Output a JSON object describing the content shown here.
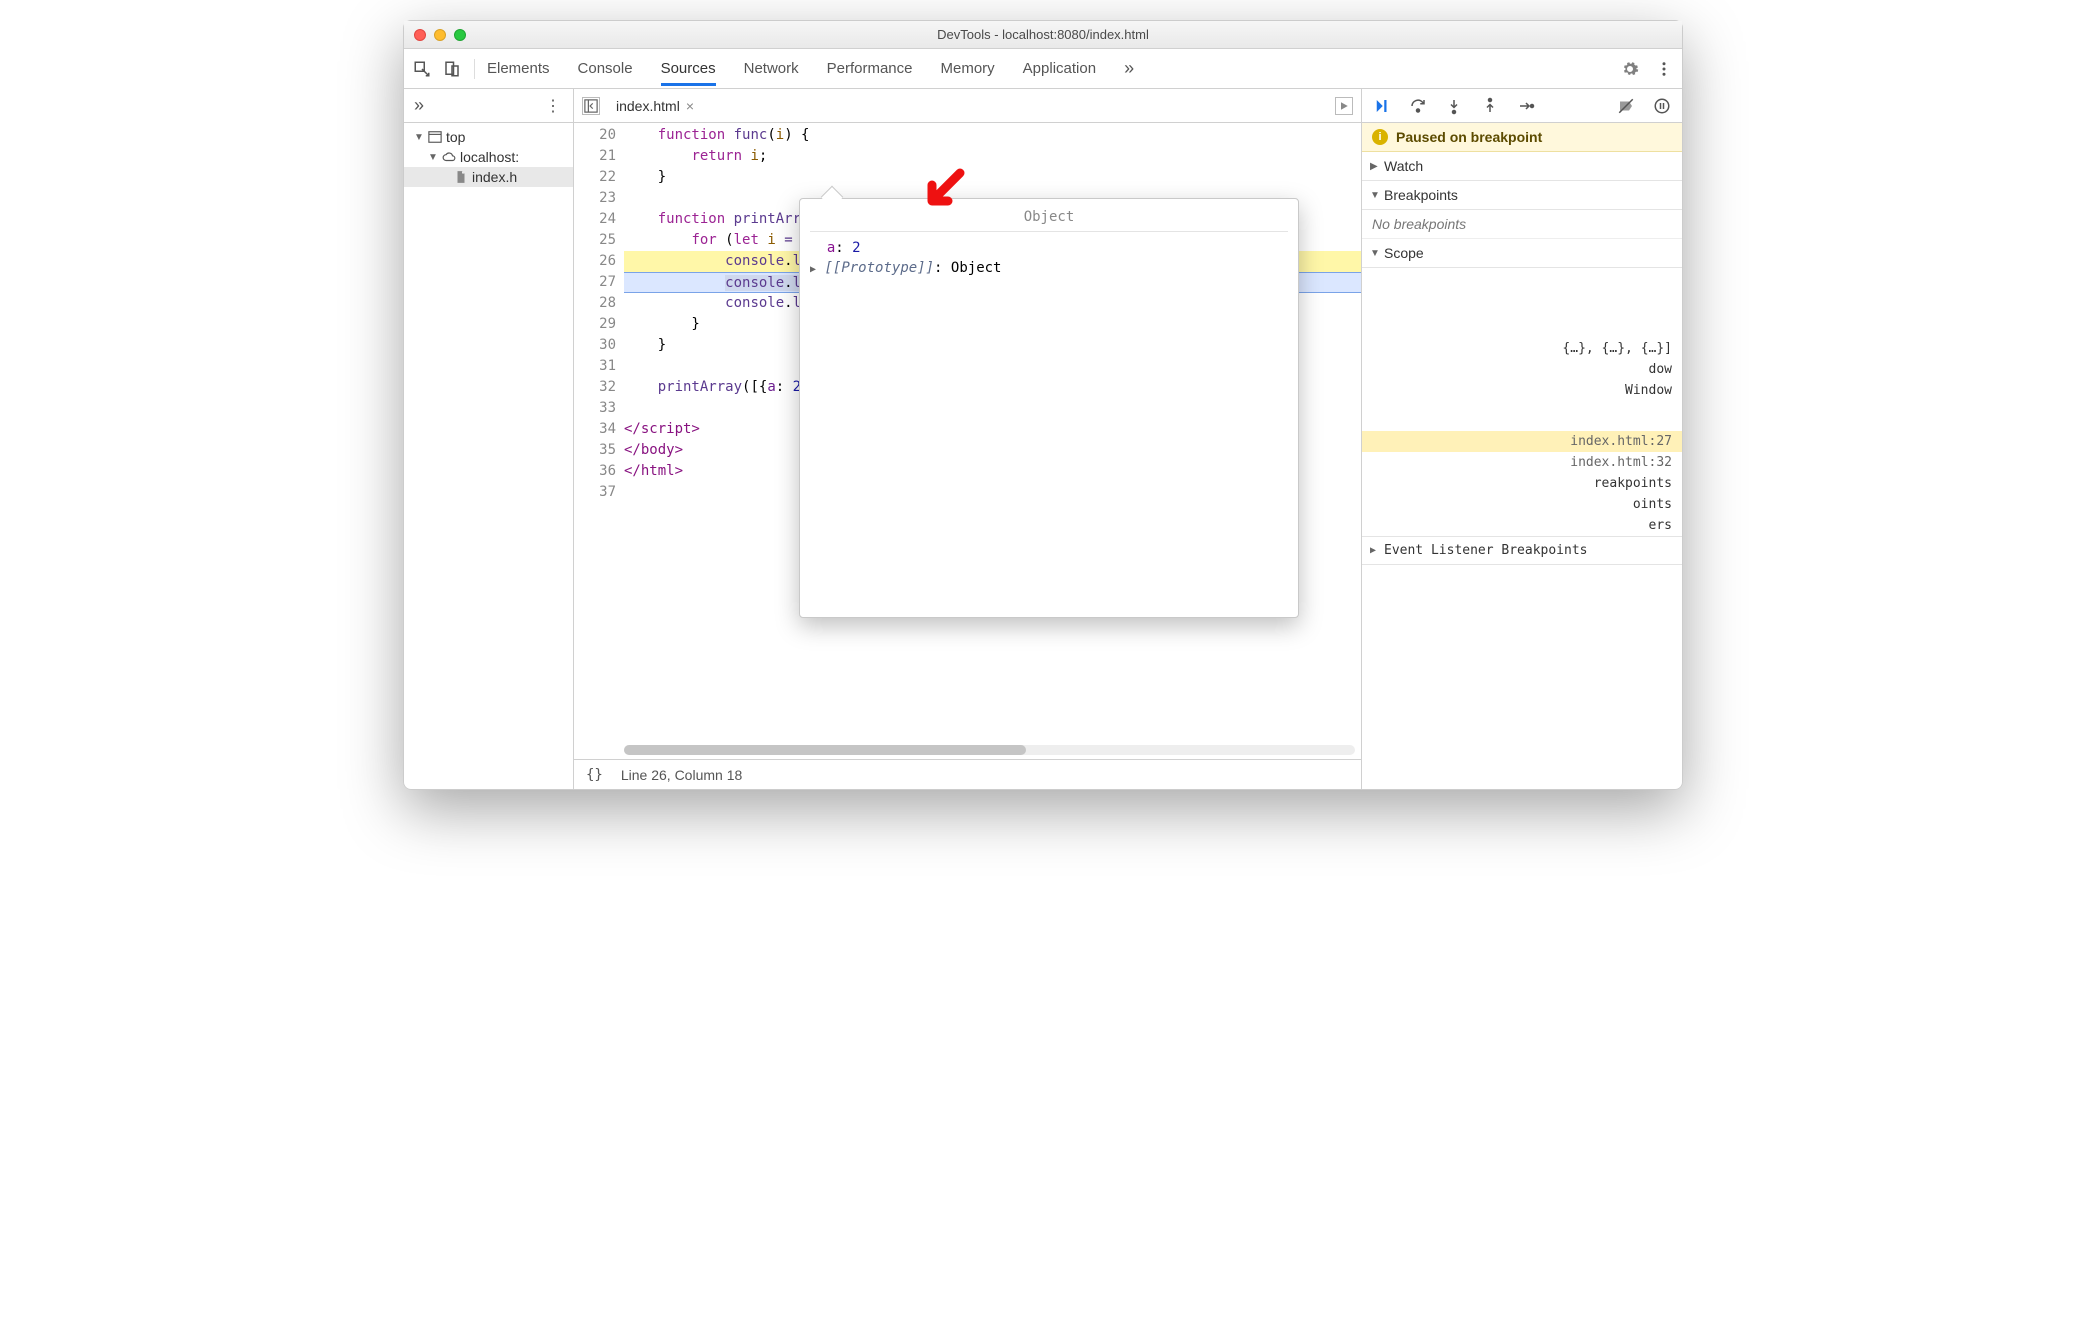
{
  "window": {
    "title": "DevTools - localhost:8080/index.html"
  },
  "mainTabs": {
    "items": [
      "Elements",
      "Console",
      "Sources",
      "Network",
      "Performance",
      "Memory",
      "Application"
    ],
    "overflow": "»",
    "active": "Sources"
  },
  "leftNav": {
    "overflow": "»",
    "more": "⋮",
    "tree": {
      "top": "top",
      "host": "localhost:",
      "file": "index.h"
    }
  },
  "fileTabs": {
    "toggleTip": "Toggle navigator",
    "active": {
      "name": "index.html",
      "close": "×"
    },
    "runTip": "Run snippet"
  },
  "editor": {
    "startLine": 20,
    "lines": [
      {
        "n": 20,
        "html": "    <span class='kw'>function</span> <span class='fn'>func</span>(<span class='param'>i</span>) {"
      },
      {
        "n": 21,
        "html": "        <span class='kw'>return</span> <span class='param'>i</span>;"
      },
      {
        "n": 22,
        "html": "    }"
      },
      {
        "n": 23,
        "html": ""
      },
      {
        "n": 24,
        "html": "    <span class='kw'>function</span> <span class='fn'>printArray</span>(<span class='param'>arr</span>) {  <span class='inline-hint'>arr = (3) [{…}, {…}, {…}</span>"
      },
      {
        "n": 25,
        "html": "        <span class='kw'>for</span> (<span class='kw'>let</span> <span class='param'>i</span> <span class='op'>=</span> <span class='num'>0</span>; <span class='param'>i</span> <span class='op'>&lt;</span> <span class='param'>arr</span>.<span class='prop'>length</span>; <span class='op'>++</span><span class='param'>i</span>) {"
      },
      {
        "n": 26,
        "cls": "hl-yellow",
        "html": "            <span class='fn'>console</span>.<span class='fn'>log</span>(<span class='param'>arr</span>[<span class='num'>0</span>].<span class='prop'>a</span>);"
      },
      {
        "n": 27,
        "cls": "hl-blue",
        "html": "            <span class='sel-token'><span class='fn'>console</span>.<span class='fn'>log</span>(<span class='param'>arr</span>[<span class='param'>i</span>]</span>.<span class='prop'>a</span>);"
      },
      {
        "n": 28,
        "html": "            <span class='fn'>console</span>.<span class='fn'>log</span>(<span class='param'>ar</span>"
      },
      {
        "n": 29,
        "html": "        }"
      },
      {
        "n": 30,
        "html": "    }"
      },
      {
        "n": 31,
        "html": ""
      },
      {
        "n": 32,
        "html": "    <span class='fn'>printArray</span>([{<span class='prop'>a</span>: <span class='num'>2</span>}, {"
      },
      {
        "n": 33,
        "html": ""
      },
      {
        "n": 34,
        "html": "<span class='tag'>&lt;/script&gt;</span>"
      },
      {
        "n": 35,
        "html": "<span class='tag'>&lt;/body&gt;</span>"
      },
      {
        "n": 36,
        "html": "<span class='tag'>&lt;/html&gt;</span>"
      },
      {
        "n": 37,
        "html": ""
      }
    ]
  },
  "statusbar": {
    "braces": "{}",
    "cursor": "Line 26, Column 18"
  },
  "debugger": {
    "pausedBanner": "Paused on breakpoint",
    "watch": {
      "label": "Watch"
    },
    "breakpoints": {
      "label": "Breakpoints",
      "empty": "No breakpoints"
    },
    "scope": {
      "label": "Scope"
    },
    "peekOverflow": [
      "{…}, {…}, {…}]",
      "dow",
      "Window"
    ],
    "callstack": [
      {
        "loc": "index.html:27",
        "hl": true
      },
      {
        "loc": "index.html:32",
        "hl": false
      }
    ],
    "otherSections": [
      "reakpoints",
      "oints",
      "ers",
      "Event Listener Breakpoints"
    ]
  },
  "hover": {
    "title": "Object",
    "propKey": "a",
    "propVal": "2",
    "protoLabel": "[[Prototype]]",
    "protoVal": "Object"
  }
}
